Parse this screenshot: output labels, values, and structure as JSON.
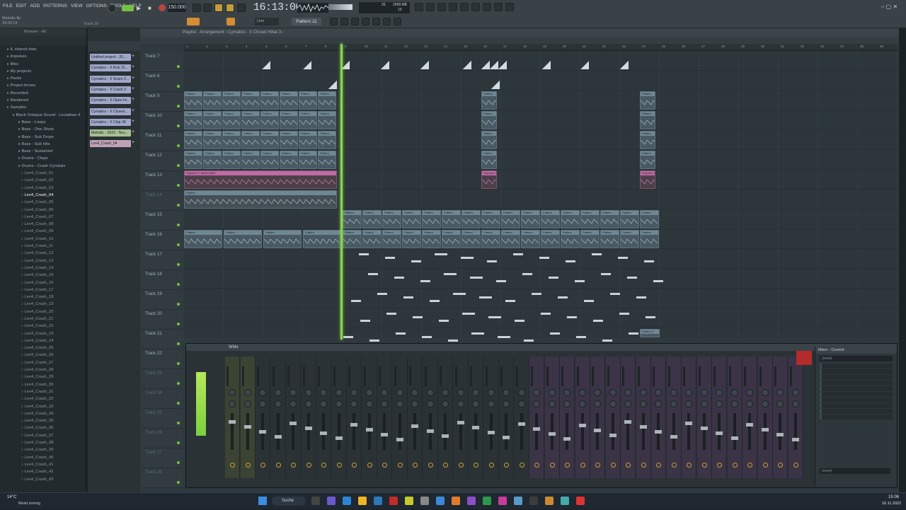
{
  "menu": [
    "FILE",
    "EDIT",
    "ADD",
    "PATTERNS",
    "VIEW",
    "OPTIONS",
    "TOOLS",
    "HELP"
  ],
  "project_hint": [
    "Melodic.flp",
    "33:03:19"
  ],
  "track_hint": "Track 16",
  "transport": {
    "bpm": "150.000",
    "time": "16:13:00",
    "pattern": "Pattern 11",
    "snap": "Line"
  },
  "cpu": {
    "mem": "2968 MB",
    "poly": "10",
    "cpu": "25"
  },
  "browser": {
    "title": "Browser - All",
    "items": [
      {
        "label": "IL shared data",
        "type": "folder"
      },
      {
        "label": "Impulses",
        "type": "folder"
      },
      {
        "label": "Misc",
        "type": "folder"
      },
      {
        "label": "My projects",
        "type": "folder"
      },
      {
        "label": "Packs",
        "type": "folder"
      },
      {
        "label": "Project bones",
        "type": "folder"
      },
      {
        "label": "Recorded",
        "type": "folder"
      },
      {
        "label": "Rendered",
        "type": "folder"
      },
      {
        "label": "Samples",
        "type": "folder"
      },
      {
        "label": "Black Octopus Sound - Leviathan 4",
        "type": "folder"
      },
      {
        "label": "Bass - Loops",
        "type": "folder"
      },
      {
        "label": "Bass - One Shots",
        "type": "folder"
      },
      {
        "label": "Bass - Sub Drops",
        "type": "folder"
      },
      {
        "label": "Bass - Sub Hits",
        "type": "folder"
      },
      {
        "label": "Bass - Sustained",
        "type": "folder"
      },
      {
        "label": "Drums - Claps",
        "type": "folder"
      },
      {
        "label": "Drums - Crash Cymbals",
        "type": "folder"
      },
      {
        "label": "Lev4_Crash_01",
        "type": "file"
      },
      {
        "label": "Lev4_Crash_02",
        "type": "file"
      },
      {
        "label": "Lev4_Crash_03",
        "type": "file"
      },
      {
        "label": "Lev4_Crash_04",
        "type": "sel"
      },
      {
        "label": "Lev4_Crash_05",
        "type": "file"
      },
      {
        "label": "Lev4_Crash_06",
        "type": "file"
      },
      {
        "label": "Lev4_Crash_07",
        "type": "file"
      },
      {
        "label": "Lev4_Crash_08",
        "type": "file"
      },
      {
        "label": "Lev4_Crash_09",
        "type": "file"
      },
      {
        "label": "Lev4_Crash_10",
        "type": "file"
      },
      {
        "label": "Lev4_Crash_11",
        "type": "file"
      },
      {
        "label": "Lev4_Crash_12",
        "type": "file"
      },
      {
        "label": "Lev4_Crash_13",
        "type": "file"
      },
      {
        "label": "Lev4_Crash_14",
        "type": "file"
      },
      {
        "label": "Lev4_Crash_15",
        "type": "file"
      },
      {
        "label": "Lev4_Crash_16",
        "type": "file"
      },
      {
        "label": "Lev4_Crash_17",
        "type": "file"
      },
      {
        "label": "Lev4_Crash_18",
        "type": "file"
      },
      {
        "label": "Lev4_Crash_19",
        "type": "file"
      },
      {
        "label": "Lev4_Crash_20",
        "type": "file"
      },
      {
        "label": "Lev4_Crash_21",
        "type": "file"
      },
      {
        "label": "Lev4_Crash_22",
        "type": "file"
      },
      {
        "label": "Lev4_Crash_23",
        "type": "file"
      },
      {
        "label": "Lev4_Crash_24",
        "type": "file"
      },
      {
        "label": "Lev4_Crash_25",
        "type": "file"
      },
      {
        "label": "Lev4_Crash_26",
        "type": "file"
      },
      {
        "label": "Lev4_Crash_27",
        "type": "file"
      },
      {
        "label": "Lev4_Crash_28",
        "type": "file"
      },
      {
        "label": "Lev4_Crash_29",
        "type": "file"
      },
      {
        "label": "Lev4_Crash_30",
        "type": "file"
      },
      {
        "label": "Lev4_Crash_31",
        "type": "file"
      },
      {
        "label": "Lev4_Crash_32",
        "type": "file"
      },
      {
        "label": "Lev4_Crash_33",
        "type": "file"
      },
      {
        "label": "Lev4_Crash_34",
        "type": "file"
      },
      {
        "label": "Lev4_Crash_35",
        "type": "file"
      },
      {
        "label": "Lev4_Crash_36",
        "type": "file"
      },
      {
        "label": "Lev4_Crash_37",
        "type": "file"
      },
      {
        "label": "Lev4_Crash_38",
        "type": "file"
      },
      {
        "label": "Lev4_Crash_39",
        "type": "file"
      },
      {
        "label": "Lev4_Crash_40",
        "type": "file"
      },
      {
        "label": "Lev4_Crash_41",
        "type": "file"
      },
      {
        "label": "Lev4_Crash_42",
        "type": "file"
      },
      {
        "label": "Lev4_Crash_43",
        "type": "file"
      }
    ]
  },
  "channels": [
    {
      "label": "Untitled project - 20...",
      "c": "a"
    },
    {
      "label": "Cymatics - X Kick 31...",
      "c": "a"
    },
    {
      "label": "Cymatics - X Snare 2...",
      "c": "a"
    },
    {
      "label": "Cymatics - X Crash 3",
      "c": "a"
    },
    {
      "label": "Cymatics - X Open Hi...",
      "c": "a"
    },
    {
      "label": "Cymatics - X Closed...",
      "c": "a"
    },
    {
      "label": "Cymatics - X Clap 38",
      "c": "a"
    },
    {
      "label": "Melodic - 2022 - Nov...",
      "c": "b"
    },
    {
      "label": "Lev4_Crash_04",
      "c": "c"
    }
  ],
  "playlist": {
    "title": "Playlist - Arrangement › Cymatics - X Closed Hihat 3 ›",
    "tracks": [
      "Track 7",
      "Track 8",
      "Track 9",
      "Track 10",
      "Track 11",
      "Track 12",
      "Track 13",
      "Track 14",
      "Track 15",
      "Track 16",
      "Track 17",
      "Track 18",
      "Track 19",
      "Track 20",
      "Track 21",
      "Track 22",
      "Track 23",
      "Track 24",
      "Track 25",
      "Track 26",
      "Track 27",
      "Track 28"
    ],
    "dim_tracks": [
      "Track 14",
      "Track 23",
      "Track 24",
      "Track 25",
      "Track 26",
      "Track 27",
      "Track 28"
    ],
    "clip_labels": {
      "pattern": "Pattern",
      "soprano": "Soprano 1, aimed pitch",
      "pattern2": "Pattern 2"
    }
  },
  "mixer": {
    "title": "Wide",
    "right_title": "Mixer - Current",
    "slot_none": "(none)"
  },
  "taskbar": {
    "weather": "Meist sonnig",
    "temp": "14°C",
    "search": "Suche",
    "time": "15:06",
    "date": "16.11.2022"
  },
  "colors": {
    "accent": "#8ad64a",
    "pink": "#c26aa4"
  }
}
